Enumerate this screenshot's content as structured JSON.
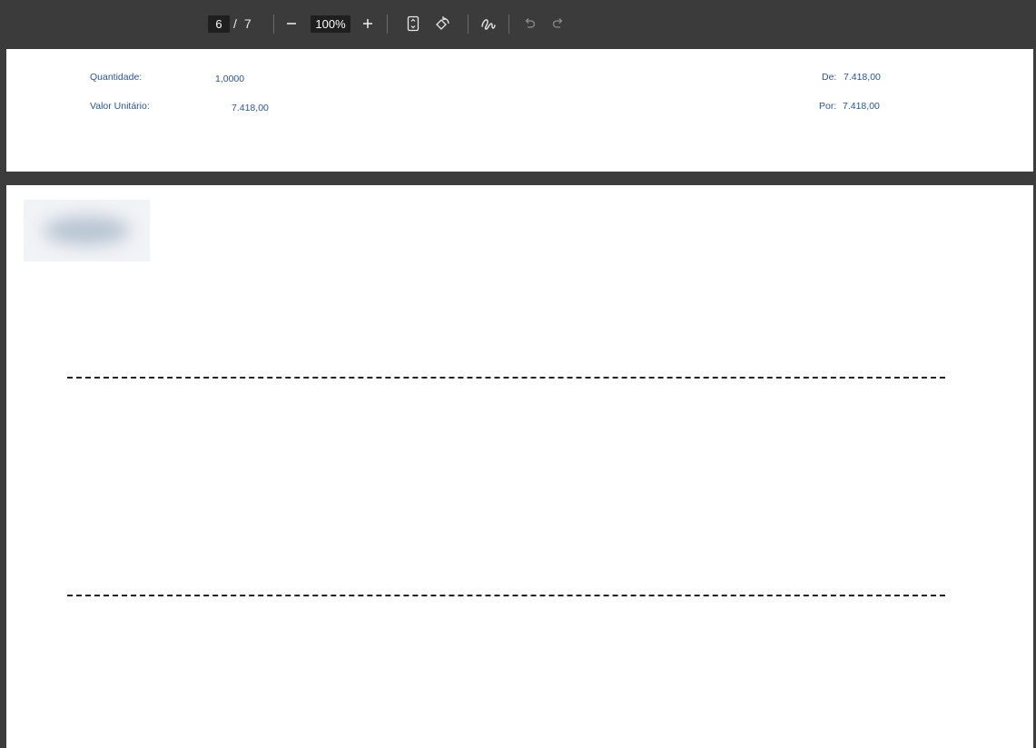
{
  "toolbar": {
    "current_page": "6",
    "page_separator": "/",
    "total_pages": "7",
    "zoom": "100%",
    "icons": {
      "zoom_out": "minus-icon",
      "zoom_in": "plus-icon",
      "fit": "fit-page-icon",
      "rotate": "rotate-icon",
      "draw": "draw-icon",
      "undo": "undo-icon",
      "redo": "redo-icon"
    }
  },
  "page_a": {
    "quantidade_label": "Quantidade:",
    "quantidade_value": "1,0000",
    "valor_label": "Valor Unitário:",
    "valor_value": "7.418,00",
    "de_label": "De:",
    "de_value": "7.418,00",
    "por_label": "Por:",
    "por_value": "7.418,00"
  },
  "colors": {
    "field_text": "#2b5588",
    "toolbar_bg": "#3b3b3b"
  }
}
